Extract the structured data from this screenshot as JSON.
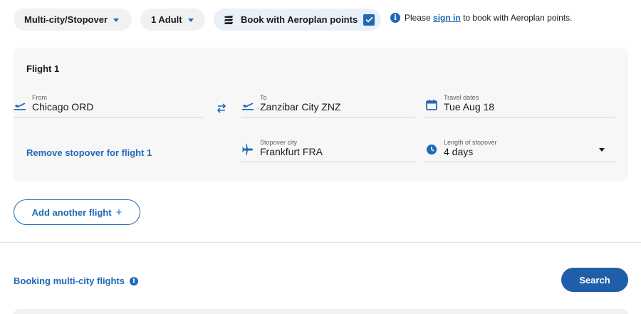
{
  "top_bar": {
    "trip_type": "Multi-city/Stopover",
    "passengers": "1 Adult",
    "aeroplan_label": "Book with Aeroplan points",
    "aeroplan_checked": true,
    "notice_prefix": "Please",
    "notice_link": "sign in",
    "notice_suffix": "to book with Aeroplan points."
  },
  "flight": {
    "title": "Flight 1",
    "from": {
      "label": "From",
      "value": "Chicago ORD",
      "icon": "takeoff-icon"
    },
    "to": {
      "label": "To",
      "value": "Zanzibar City ZNZ",
      "icon": "takeoff-icon"
    },
    "dates": {
      "label": "Travel dates",
      "value": "Tue Aug 18",
      "icon": "calendar-icon"
    },
    "remove_stopover": "Remove stopover for flight 1",
    "stopover": {
      "label": "Stopover city",
      "value": "Frankfurt FRA",
      "icon": "airplane-icon"
    },
    "length": {
      "label": "Length of stopover",
      "value": "4 days",
      "icon": "clock-icon"
    }
  },
  "actions": {
    "add_flight": "Add another flight",
    "add_flight_symbol": "+",
    "booking_help": "Booking multi-city flights",
    "search": "Search"
  },
  "colors": {
    "accent": "#2169b6",
    "search_button": "#1f5fa9",
    "card_background": "#f7f7f7"
  }
}
